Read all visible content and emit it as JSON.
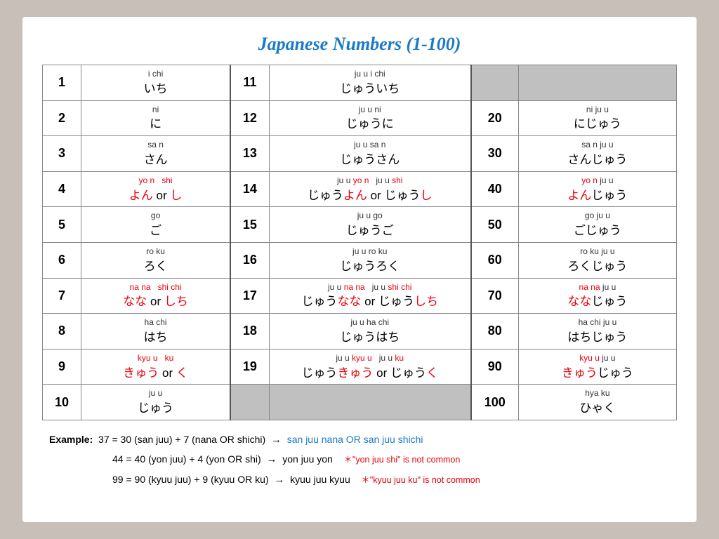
{
  "title": "Japanese Numbers (1-100)",
  "numbers": [
    {
      "num": "1",
      "roma": "i  chi",
      "kana": "いち"
    },
    {
      "num": "2",
      "roma": "ni",
      "kana": "に"
    },
    {
      "num": "3",
      "roma": "sa n",
      "kana": "さん"
    },
    {
      "num": "4",
      "roma_plain": "yo n",
      "roma_red": "shi",
      "kana_plain": "よん",
      "kana_red": "し",
      "has_or": true
    },
    {
      "num": "5",
      "roma": "go",
      "kana": "ご"
    },
    {
      "num": "6",
      "roma": "ro ku",
      "kana": "ろく"
    },
    {
      "num": "7",
      "roma_plain": "na na",
      "roma_red": "shi chi",
      "kana_plain": "なな",
      "kana_red": "しち",
      "has_or": true
    },
    {
      "num": "8",
      "roma": "ha chi",
      "kana": "はち"
    },
    {
      "num": "9",
      "roma_plain": "kyu  u",
      "roma_red": "ku",
      "kana_plain": "きゅう",
      "kana_red": "く",
      "has_or": true
    },
    {
      "num": "10",
      "roma": "ju  u",
      "kana": "じゅう"
    }
  ],
  "numbers11": [
    {
      "num": "11",
      "roma": "ju  u  i  chi",
      "kana": "じゅういち"
    },
    {
      "num": "12",
      "roma": "ju  u  ni",
      "kana": "じゅうに"
    },
    {
      "num": "13",
      "roma": "ju  u  sa n",
      "kana": "じゅうさん"
    },
    {
      "num": "14",
      "roma_p1": "ju  u",
      "roma_red1": "yo n",
      "roma_p2": "ju  u",
      "roma_red2": "shi",
      "kana_p1": "じゅう",
      "kana_red1": "よん",
      "kana_p2": "or  じゅう",
      "kana_red2": "し",
      "has_or": true
    },
    {
      "num": "15",
      "roma": "ju  u  go",
      "kana": "じゅうご"
    },
    {
      "num": "16",
      "roma": "ju  u  ro ku",
      "kana": "じゅうろく"
    },
    {
      "num": "17",
      "roma_p1": "ju  u",
      "roma_red1": "na na",
      "roma_p2": "ju  u",
      "roma_red2": "shi chi",
      "kana_p1": "じゅう",
      "kana_red1": "なな",
      "kana_p2": "or  じゅう",
      "kana_red2": "しち",
      "has_or": true
    },
    {
      "num": "18",
      "roma": "ju  u  ha chi",
      "kana": "じゅうはち"
    },
    {
      "num": "19",
      "roma_p1": "ju  u",
      "roma_red1": "kyu u",
      "roma_p2": "ju  u",
      "roma_red2": "ku",
      "kana_p1": "じゅう",
      "kana_red1": "きゅう",
      "kana_p2": "or  じゅう",
      "kana_red2": "く",
      "has_or": true
    }
  ],
  "numbers20": [
    {
      "num": "20",
      "roma": "ni  ju  u",
      "kana": "にじゅう"
    },
    {
      "num": "30",
      "roma": "sa n  ju  u",
      "kana": "さんじゅう"
    },
    {
      "num": "40",
      "roma_plain": "yo n",
      "roma_black": "ju  u",
      "kana_plain": "よん",
      "kana_black": "じゅう",
      "is_red_prefix": true
    },
    {
      "num": "50",
      "roma": "go  ju  u",
      "kana": "ごじゅう"
    },
    {
      "num": "60",
      "roma": "ro ku  ju  u",
      "kana": "ろくじゅう"
    },
    {
      "num": "70",
      "roma_plain": "na na",
      "roma_black": "ju  u",
      "kana_plain": "なな",
      "kana_black": "じゅう",
      "is_red_prefix": true
    },
    {
      "num": "80",
      "roma": "ha chi  ju  u",
      "kana": "はちじゅう"
    },
    {
      "num": "90",
      "roma_plain": "kyu  u",
      "roma_black": "ju  u",
      "kana_plain": "きゅう",
      "kana_black": "じゅう",
      "is_red_prefix": true
    },
    {
      "num": "100",
      "roma": "hya  ku",
      "kana": "ひゃく"
    }
  ],
  "examples": {
    "ex1_pre": "Example:  37 = 30 (san juu) + 7 (nana OR shichi)  →",
    "ex1_blue": "san juu nana OR san juu shichi",
    "ex2_pre": "44 = 40 (yon juu) + 4 (yon OR shi)  →",
    "ex2_black": "yon juu yon",
    "ex2_red": "＊\"yon juu shi\" is not common",
    "ex3_pre": "99 = 90 (kyuu juu) + 9 (kyuu OR ku)  →",
    "ex3_black": "kyuu juu kyuu",
    "ex3_red": "＊\"kyuu juu ku\" is not common"
  }
}
